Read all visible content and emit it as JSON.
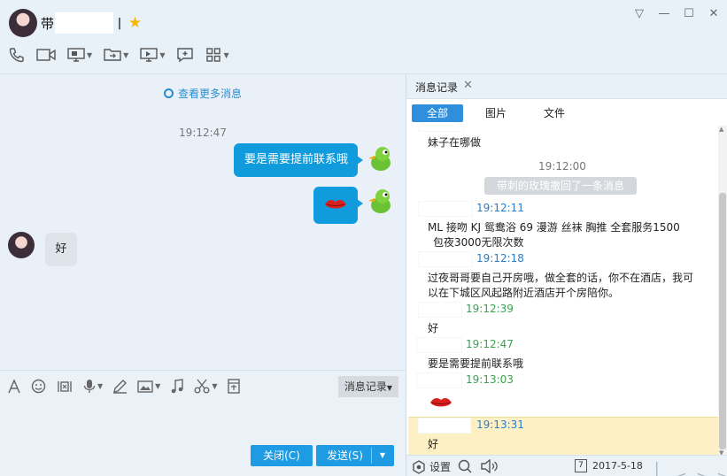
{
  "header": {
    "title_prefix": "带",
    "title_suffix": "ㅣ",
    "window_controls": [
      "▽",
      "—",
      "☐",
      "✕"
    ]
  },
  "chat": {
    "more_messages": "查看更多消息",
    "timestamp": "19:12:47",
    "messages": [
      {
        "direction": "out",
        "text": "要是需要提前联系哦"
      },
      {
        "direction": "out",
        "emoji": "lips-icon"
      },
      {
        "direction": "in",
        "text": "好"
      }
    ]
  },
  "input": {
    "history_button": "消息记录",
    "close_button": "关闭(C)",
    "send_button": "发送(S)"
  },
  "panel": {
    "tab_label": "消息记录",
    "filters": [
      "全部",
      "图片",
      "文件"
    ],
    "log": {
      "first_text": "妹子在哪做",
      "center_time": "19:12:00",
      "recall_notice": "带刺的玫瑰撤回了一条消息",
      "entries": [
        {
          "time": "19:12:11",
          "color": "#2b7dc8",
          "text1": "ML  接吻  KJ  鸳鸯浴  69  漫游    丝袜  胸推  全套服务1500",
          "text2": "包夜3000无限次数"
        },
        {
          "time": "19:12:18",
          "color": "#2b7dc8",
          "text1": "过夜哥哥要自己开房哦，做全套的话，你不在酒店，我可",
          "text2": "以在下城区风起路附近酒店开个房陪你。"
        },
        {
          "time": "19:12:39",
          "color": "#3aa350",
          "text1": "好"
        },
        {
          "time": "19:12:47",
          "color": "#3aa350",
          "text1": "要是需要提前联系哦"
        },
        {
          "time": "19:13:03",
          "color": "#3aa350",
          "emoji": "lips-icon"
        },
        {
          "time": "19:13:31",
          "color": "#2b7dc8",
          "text1": "好"
        }
      ]
    },
    "footer": {
      "settings": "设置",
      "date": "2017-5-18",
      "calendar_day": "7"
    }
  }
}
